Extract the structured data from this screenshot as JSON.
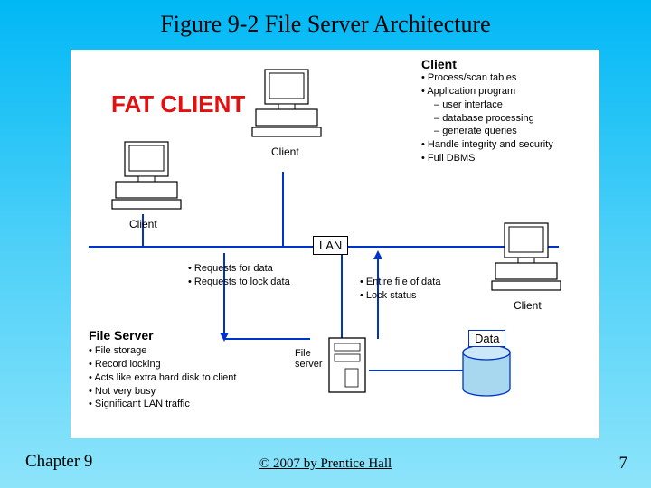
{
  "title": "Figure 9-2 File Server Architecture",
  "fat_client": "FAT CLIENT",
  "labels": {
    "client_top": "Client",
    "client_left": "Client",
    "client_mid": "Client",
    "client_right": "Client",
    "lan": "LAN",
    "file_server_heading": "File Server",
    "file_server_small": "File\nserver",
    "data": "Data"
  },
  "client_bullets": {
    "heading": "Client",
    "items": [
      {
        "text": "Process/scan tables"
      },
      {
        "text": "Application program"
      },
      {
        "text": "user interface",
        "sub": true
      },
      {
        "text": "database processing",
        "sub": true
      },
      {
        "text": "generate queries",
        "sub": true
      },
      {
        "text": "Handle integrity and security"
      },
      {
        "text": "Full DBMS"
      }
    ]
  },
  "requests_bullets": [
    "Requests for data",
    "Requests to lock data"
  ],
  "entire_bullets": [
    "Entire file of data",
    "Lock status"
  ],
  "file_server_bullets": [
    "File storage",
    "Record locking",
    "Acts like extra hard disk to client",
    "Not very busy",
    "Significant LAN traffic"
  ],
  "footer": {
    "chapter": "Chapter 9",
    "copyright": "© 2007 by Prentice Hall",
    "page": "7"
  }
}
